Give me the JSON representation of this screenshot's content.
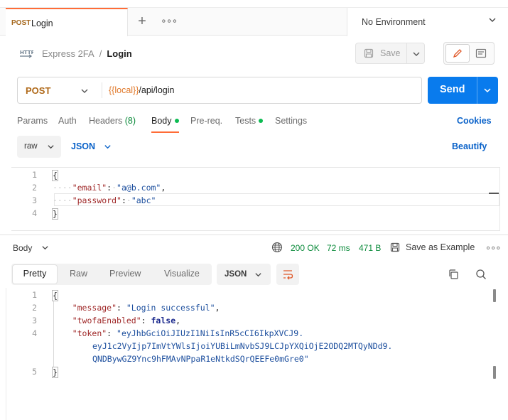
{
  "tab": {
    "method": "POST",
    "name": "Login"
  },
  "environment": {
    "label": "No Environment"
  },
  "breadcrumb": {
    "collection": "Express 2FA",
    "separator": "/",
    "request": "Login"
  },
  "save": {
    "label": "Save"
  },
  "request": {
    "method": "POST",
    "url_variable": "{{local}}",
    "url_path": "/api/login",
    "send_label": "Send"
  },
  "request_tabs": [
    {
      "label": "Params"
    },
    {
      "label": "Auth"
    },
    {
      "label": "Headers",
      "count": "(8)"
    },
    {
      "label": "Body",
      "dot": true
    },
    {
      "label": "Pre-req."
    },
    {
      "label": "Tests",
      "dot": true
    },
    {
      "label": "Settings"
    }
  ],
  "cookies_label": "Cookies",
  "body_mode": {
    "mode": "raw",
    "format": "JSON",
    "beautify_label": "Beautify"
  },
  "request_body": {
    "line_numbers": [
      "1",
      "2",
      "3",
      "4"
    ],
    "open": "{",
    "close": "}",
    "email_key": "\"email\"",
    "email_value": "\"a@b.com\"",
    "password_key": "\"password\"",
    "password_value": "\"abc\""
  },
  "response": {
    "label": "Body",
    "status": "200 OK",
    "time": "72 ms",
    "size": "471 B",
    "save_example_label": "Save as Example",
    "views": [
      "Pretty",
      "Raw",
      "Preview",
      "Visualize"
    ],
    "format": "JSON",
    "line_numbers": [
      "1",
      "2",
      "3",
      "4",
      "5"
    ],
    "message_key": "\"message\"",
    "message_value": "\"Login successful\"",
    "twofa_key": "\"twofaEnabled\"",
    "twofa_value": "false",
    "token_key": "\"token\"",
    "token_line1": "\"eyJhbGciOiJIUzI1NiIsInR5cCI6IkpXVCJ9.",
    "token_line2": "eyJ1c2VyIjp7ImVtYWlsIjoiYUBiLmNvbSJ9LCJpYXQiOjE2ODQ2MTQyNDd9.",
    "token_line3": "QNDBywGZ9Ync9hFMAvNPpaR1eNtkdSQrQEEFe0mGre0\""
  }
}
